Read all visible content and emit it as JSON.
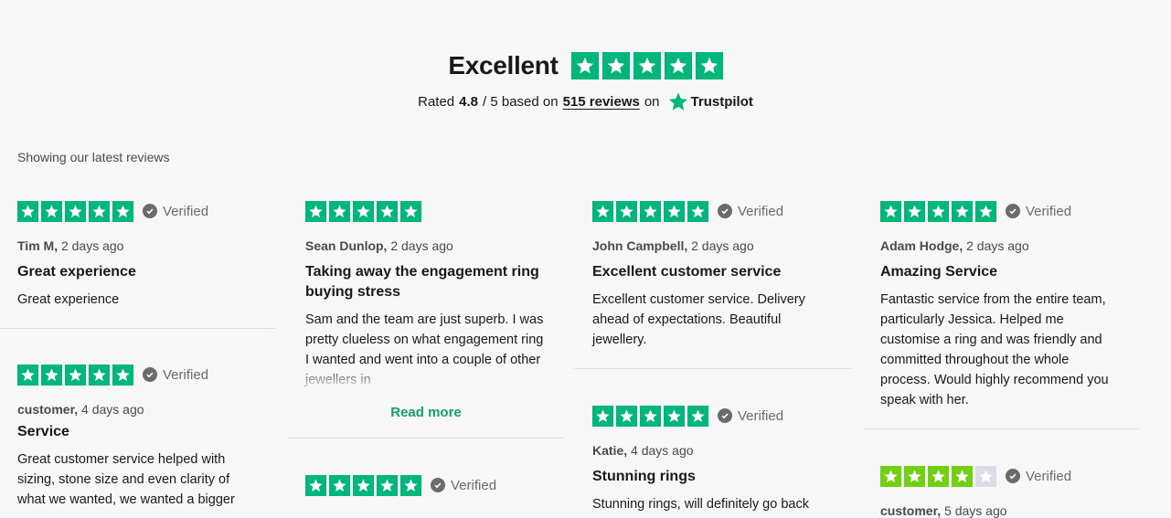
{
  "header": {
    "headline": "Excellent",
    "rated_prefix": "Rated",
    "rating": "4.8",
    "rating_suffix": "/ 5 based on",
    "reviews_link": "515 reviews",
    "on_text": "on",
    "brand": "Trustpilot"
  },
  "showing_label": "Showing our latest reviews",
  "colors": {
    "star_green": "#00b67a",
    "four_star_green": "#73cf11",
    "link_green": "#14a06a"
  },
  "columns": [
    {
      "cards": [
        {
          "stars": 5,
          "verified": "Verified",
          "author": "Tim M,",
          "date": "2 days ago",
          "title": "Great experience",
          "body": "Great experience"
        },
        {
          "stars": 5,
          "verified": "Verified",
          "author": "customer,",
          "date": "4 days ago",
          "title": "Service",
          "body": "Great customer service helped with sizing, stone size and even clarity of what we wanted, we wanted a bigger"
        }
      ]
    },
    {
      "cards": [
        {
          "stars": 5,
          "author": "Sean Dunlop,",
          "date": "2 days ago",
          "title": "Taking away the engagement ring buying stress",
          "body": "Sam and the team are just superb. I was pretty clueless on what engagement ring I wanted and went into a couple of other jewellers in",
          "read_more": "Read more"
        },
        {
          "stars": 5,
          "verified": "Verified"
        }
      ]
    },
    {
      "cards": [
        {
          "stars": 5,
          "verified": "Verified",
          "author": "John Campbell,",
          "date": "2 days ago",
          "title": "Excellent customer service",
          "body": "Excellent customer service. Delivery ahead of expectations. Beautiful jewellery."
        },
        {
          "stars": 5,
          "verified": "Verified",
          "author": "Katie,",
          "date": "4 days ago",
          "title": "Stunning rings",
          "body": "Stunning rings, will definitely go back"
        }
      ]
    },
    {
      "cards": [
        {
          "stars": 5,
          "verified": "Verified",
          "author": "Adam Hodge,",
          "date": "2 days ago",
          "title": "Amazing Service",
          "body": "Fantastic service from the entire team, particularly Jessica. Helped me customise a ring and was friendly and committed throughout the whole process. Would highly recommend you speak with her."
        },
        {
          "stars": 4,
          "verified": "Verified",
          "author": "customer,",
          "date": "5 days ago"
        }
      ]
    }
  ]
}
